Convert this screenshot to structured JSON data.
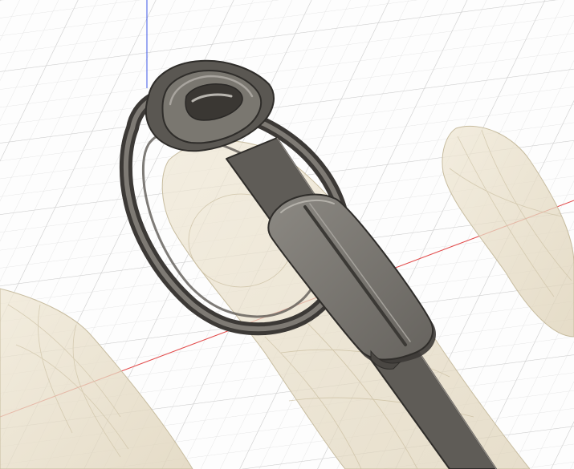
{
  "viewport": {
    "background": "#fdfdfd",
    "grid_minor_color": "#e4e4e4",
    "grid_major_color": "#c9c9c9"
  },
  "axes": {
    "x_axis_color": "#e24a4a",
    "y_axis_color": "#3a55e6"
  },
  "model": {
    "skin_fill": "#e8dfc9",
    "skin_stroke": "#c7bc9f",
    "ring_fill": "#6c6862",
    "ring_dark": "#3c3936",
    "ring_highlight": "#b9b6b0",
    "strap_fill": "#5f5c57",
    "strap_edge": "#2f2d2a",
    "pad_fill": "#7d7a74",
    "pad_top": "#98958f"
  }
}
